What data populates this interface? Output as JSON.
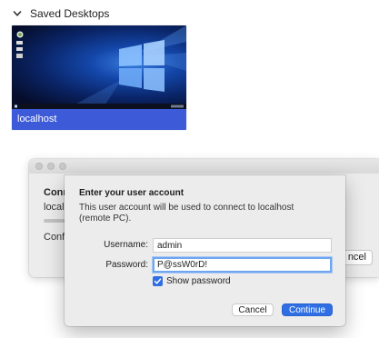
{
  "saved_desktops": {
    "header": "Saved Desktops",
    "expanded_icon": "chevron-down-icon",
    "desktops": [
      {
        "name": "localhost",
        "label_color": "#3d5bd9"
      }
    ]
  },
  "background_dialog": {
    "heading_visible": "Conn",
    "host_visible": "localh",
    "status_visible": "Confi",
    "cancel_visible": "ncel"
  },
  "dialog": {
    "title": "Enter your user account",
    "description": "This user account will be used to connect to localhost (remote PC).",
    "username_label": "Username:",
    "username_value": "admin",
    "password_label": "Password:",
    "password_value": "P@ssW0rD!",
    "show_password_label": "Show password",
    "show_password_checked": true,
    "cancel_label": "Cancel",
    "continue_label": "Continue",
    "accent_color": "#2f6fe3"
  }
}
